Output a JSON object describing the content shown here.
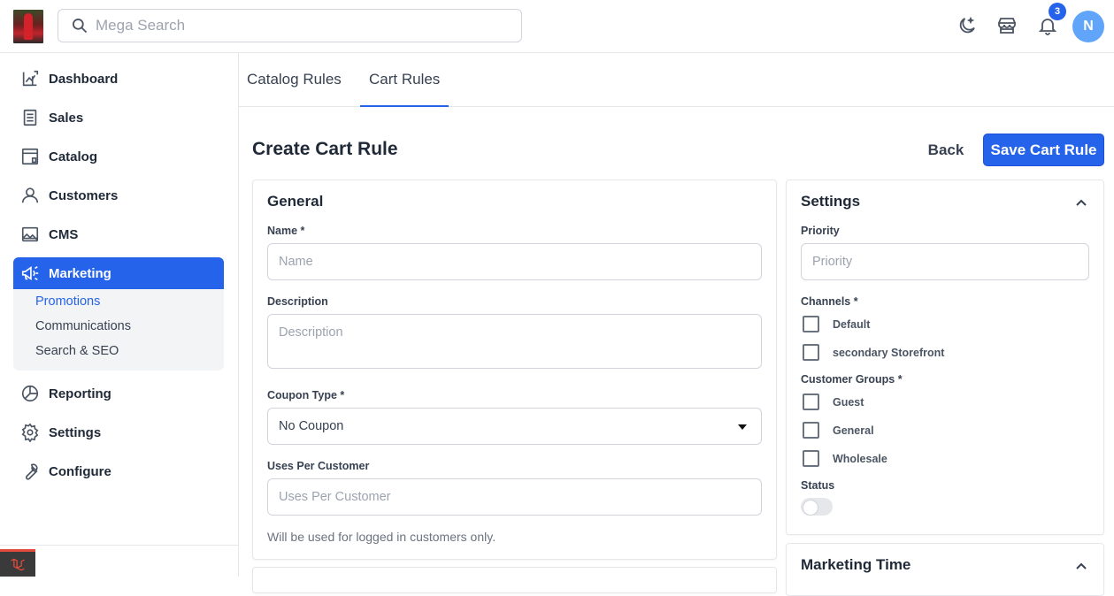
{
  "header": {
    "search_placeholder": "Mega Search",
    "notification_count": "3",
    "avatar_initial": "N"
  },
  "sidebar": {
    "items": [
      {
        "label": "Dashboard",
        "icon": "dashboard-icon"
      },
      {
        "label": "Sales",
        "icon": "sales-icon"
      },
      {
        "label": "Catalog",
        "icon": "catalog-icon"
      },
      {
        "label": "Customers",
        "icon": "customers-icon"
      },
      {
        "label": "CMS",
        "icon": "cms-icon"
      },
      {
        "label": "Marketing",
        "icon": "marketing-icon"
      },
      {
        "label": "Reporting",
        "icon": "reporting-icon"
      },
      {
        "label": "Settings",
        "icon": "settings-icon"
      },
      {
        "label": "Configure",
        "icon": "configure-icon"
      }
    ],
    "marketing_sub": [
      "Promotions",
      "Communications",
      "Search & SEO"
    ]
  },
  "tabs": [
    "Catalog Rules",
    "Cart Rules"
  ],
  "page": {
    "title": "Create Cart Rule",
    "back_label": "Back",
    "save_label": "Save Cart Rule"
  },
  "general": {
    "title": "General",
    "name_label": "Name *",
    "name_placeholder": "Name",
    "description_label": "Description",
    "description_placeholder": "Description",
    "coupon_type_label": "Coupon Type *",
    "coupon_type_value": "No Coupon",
    "uses_label": "Uses Per Customer",
    "uses_placeholder": "Uses Per Customer",
    "uses_hint": "Will be used for logged in customers only."
  },
  "settings": {
    "title": "Settings",
    "priority_label": "Priority",
    "priority_placeholder": "Priority",
    "channels_label": "Channels *",
    "channels": [
      "Default",
      "secondary Storefront"
    ],
    "groups_label": "Customer Groups *",
    "groups": [
      "Guest",
      "General",
      "Wholesale"
    ],
    "status_label": "Status"
  },
  "marketing_time": {
    "title": "Marketing Time"
  },
  "colors": {
    "accent": "#2563eb"
  }
}
